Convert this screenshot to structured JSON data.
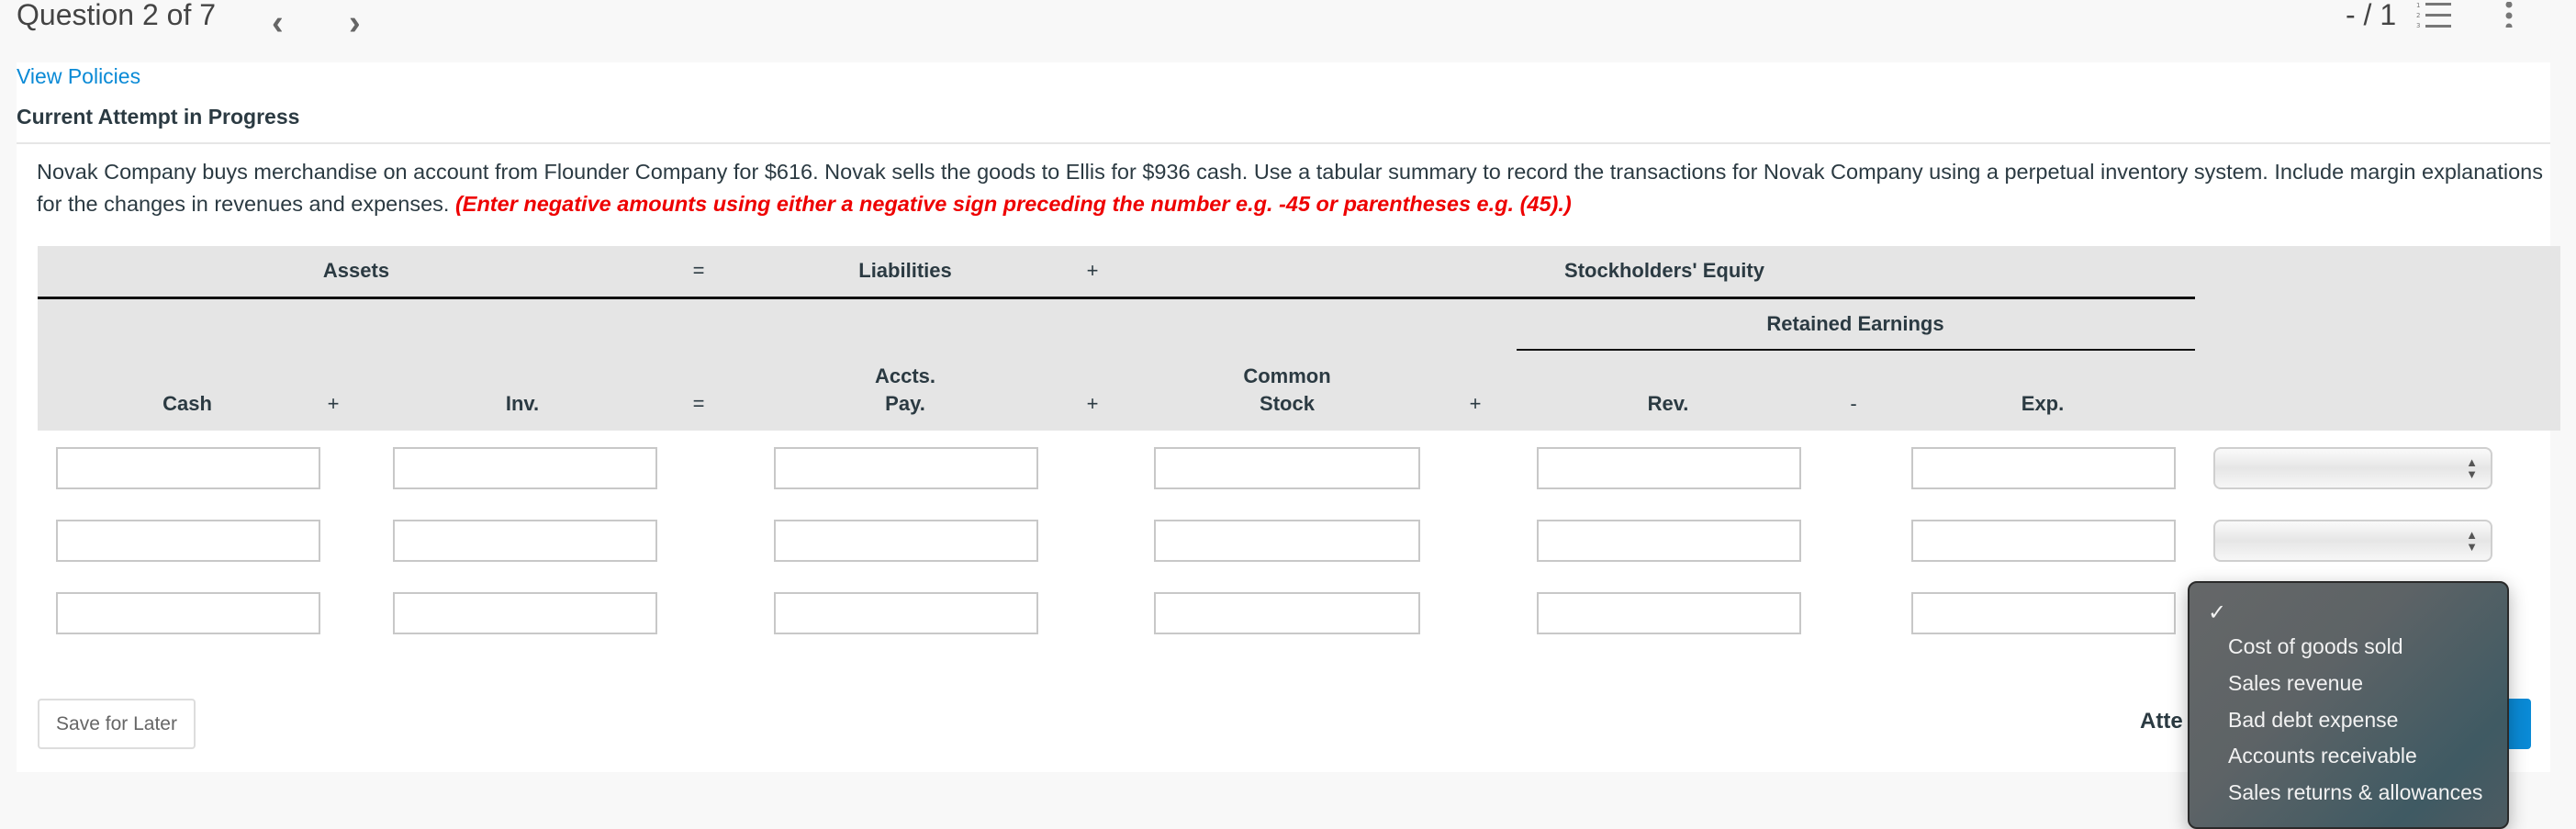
{
  "topbar": {
    "question_label": "Question 2 of 7",
    "prev_icon": "chevron-left-icon",
    "next_icon": "chevron-right-icon",
    "score": "- / 1",
    "list_icon": "numbered-list-icon",
    "more_icon": "more-vertical-icon"
  },
  "links": {
    "view_policies": "View Policies"
  },
  "attempt_status": "Current Attempt in Progress",
  "question": {
    "text": "Novak Company buys merchandise on account from Flounder Company for $616. Novak sells the goods to Ellis for $936 cash. Use a tabular summary to record the transactions for Novak Company using a perpetual inventory system. Include margin explanations for the changes in revenues and expenses. ",
    "instruction": "(Enter negative amounts using either a negative sign preceding the number e.g. -45 or parentheses e.g. (45).)"
  },
  "table": {
    "groups": {
      "assets": "Assets",
      "eq": "=",
      "liabilities": "Liabilities",
      "plus": "+",
      "equity": "Stockholders' Equity",
      "retained": "Retained Earnings"
    },
    "columns": {
      "cash": "Cash",
      "plus1": "+",
      "inv": "Inv.",
      "eq": "=",
      "ap1": "Accts.",
      "ap2": "Pay.",
      "plus2": "+",
      "cs1": "Common",
      "cs2": "Stock",
      "plus3": "+",
      "rev": "Rev.",
      "minus": "-",
      "exp": "Exp."
    },
    "rows": [
      {
        "cash": "",
        "inv": "",
        "ap": "",
        "cs": "",
        "rev": "",
        "exp": "",
        "explanation": ""
      },
      {
        "cash": "",
        "inv": "",
        "ap": "",
        "cs": "",
        "rev": "",
        "exp": "",
        "explanation": ""
      },
      {
        "cash": "",
        "inv": "",
        "ap": "",
        "cs": "",
        "rev": "",
        "exp": "",
        "explanation": ""
      }
    ]
  },
  "footer": {
    "save_label": "Save for Later",
    "attempts_label": "Atte"
  },
  "dropdown": {
    "options": [
      "Cost of goods sold",
      "Sales revenue",
      "Bad debt expense",
      "Accounts receivable",
      "Sales returns & allowances"
    ]
  },
  "colors": {
    "link": "#0a8ad6",
    "instruction": "#ee0000",
    "submit": "#0a8ad6"
  }
}
